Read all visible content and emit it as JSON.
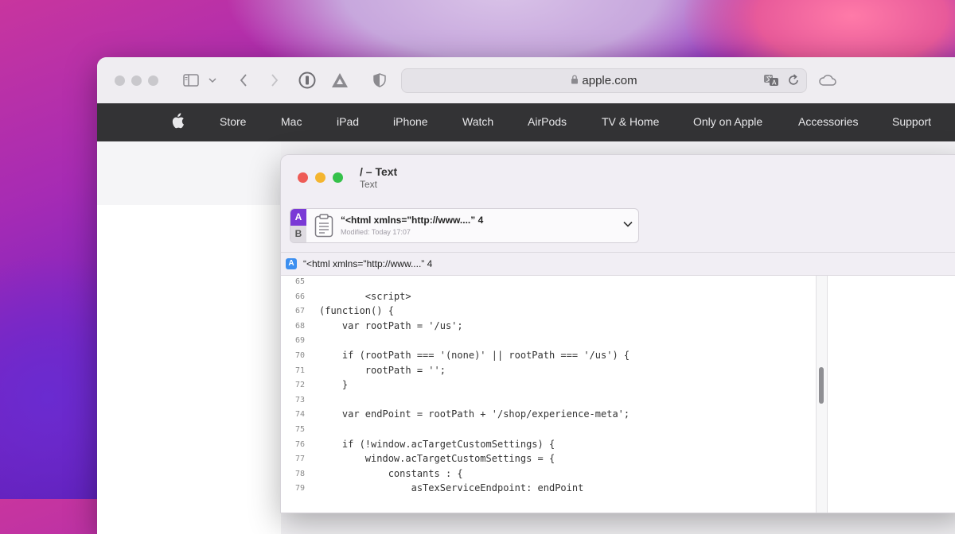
{
  "safari": {
    "address": "apple.com",
    "nav_items": [
      "Store",
      "Mac",
      "iPad",
      "iPhone",
      "Watch",
      "AirPods",
      "TV & Home",
      "Only on Apple",
      "Accessories",
      "Support"
    ]
  },
  "text_window": {
    "title": "/ – Text",
    "subtitle": "Text",
    "card": {
      "badge_a": "A",
      "badge_b": "B",
      "title": "“<html xmlns=\"http://www....” 4",
      "modified": "Modified: Today 17:07"
    },
    "path": {
      "badge": "A",
      "text": "“<html xmlns=\"http://www....” 4"
    },
    "code_lines": [
      {
        "n": "65",
        "t": ""
      },
      {
        "n": "66",
        "t": "        <script>"
      },
      {
        "n": "67",
        "t": "(function() {"
      },
      {
        "n": "68",
        "t": "    var rootPath = '/us';"
      },
      {
        "n": "69",
        "t": ""
      },
      {
        "n": "70",
        "t": "    if (rootPath === '(none)' || rootPath === '/us') {"
      },
      {
        "n": "71",
        "t": "        rootPath = '';"
      },
      {
        "n": "72",
        "t": "    }"
      },
      {
        "n": "73",
        "t": ""
      },
      {
        "n": "74",
        "t": "    var endPoint = rootPath + '/shop/experience-meta';"
      },
      {
        "n": "75",
        "t": ""
      },
      {
        "n": "76",
        "t": "    if (!window.acTargetCustomSettings) {"
      },
      {
        "n": "77",
        "t": "        window.acTargetCustomSettings = {"
      },
      {
        "n": "78",
        "t": "            constants : {"
      },
      {
        "n": "79",
        "t": "                asTexServiceEndpoint: endPoint"
      }
    ]
  }
}
